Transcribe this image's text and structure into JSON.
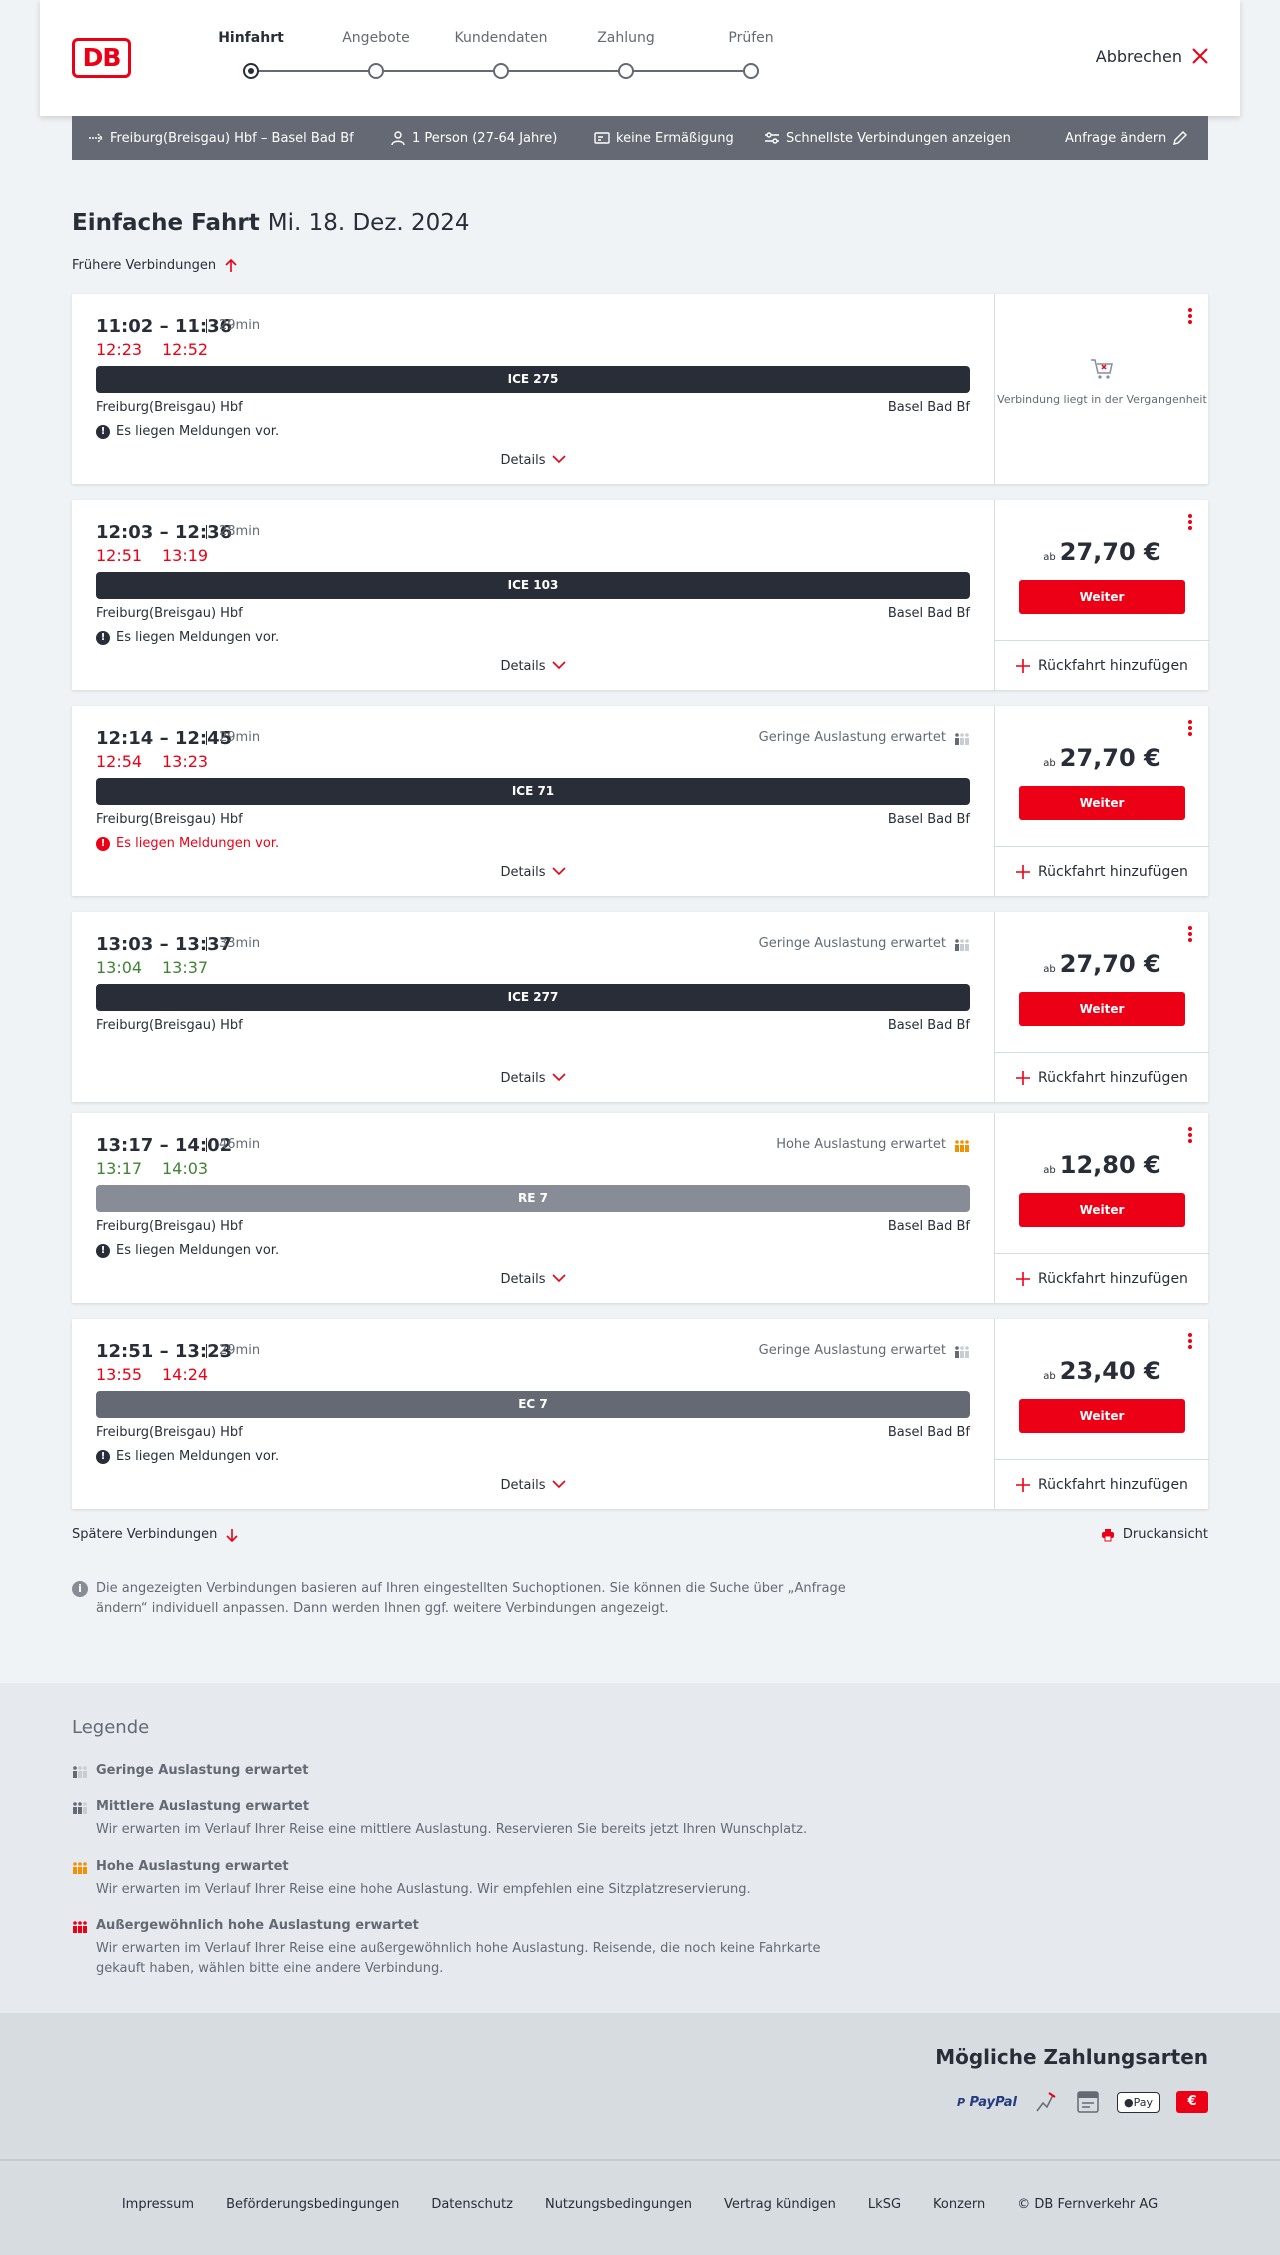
{
  "header": {
    "logo": "DB",
    "steps": [
      "Hinfahrt",
      "Angebote",
      "Kundendaten",
      "Zahlung",
      "Prüfen"
    ],
    "active_step": 0,
    "cancel": "Abbrechen"
  },
  "query": {
    "route": "Freiburg(Breisgau) Hbf – Basel Bad Bf",
    "persons": "1 Person (27-64 Jahre)",
    "discount": "keine Ermäßigung",
    "fastest": "Schnellste Verbindungen anzeigen",
    "change": "Anfrage ändern"
  },
  "page": {
    "title": "Einfache Fahrt",
    "date": "Mi. 18. Dez. 2024",
    "earlier": "Frühere Verbindungen",
    "later": "Spätere Verbindungen",
    "print": "Druckansicht",
    "info": "Die angezeigten Verbindungen basieren auf Ihren eingestellten Suchoptionen. Sie können die Suche über „Anfrage ändern“ individuell anpassen. Dann werden Ihnen ggf. weitere Verbindungen angezeigt."
  },
  "labels": {
    "details": "Details",
    "weiter": "Weiter",
    "rueckfahrt": "Rückfahrt hinzufügen",
    "ab": "ab",
    "past": "Verbindung liegt in der Vergangenheit"
  },
  "connections": [
    {
      "times": "11:02 – 11:36",
      "duration": "29min",
      "rt_dep": "12:23",
      "rt_arr": "12:52",
      "rt_status": "late",
      "load": "",
      "train": "ICE 275",
      "train_color": "#282d37",
      "from": "Freiburg(Breisgau) Hbf",
      "to": "Basel Bad Bf",
      "message": "Es liegen Meldungen vor.",
      "message_level": "info",
      "price": "",
      "past": true
    },
    {
      "times": "12:03 – 12:36",
      "duration": "28min",
      "rt_dep": "12:51",
      "rt_arr": "13:19",
      "rt_status": "late",
      "load": "",
      "train": "ICE 103",
      "train_color": "#282d37",
      "from": "Freiburg(Breisgau) Hbf",
      "to": "Basel Bad Bf",
      "message": "Es liegen Meldungen vor.",
      "message_level": "info",
      "price": "27,70 €",
      "past": false
    },
    {
      "times": "12:14 – 12:45",
      "duration": "29min",
      "rt_dep": "12:54",
      "rt_arr": "13:23",
      "rt_status": "late",
      "load": "Geringe Auslastung erwartet",
      "load_level": "low",
      "train": "ICE 71",
      "train_color": "#282d37",
      "from": "Freiburg(Breisgau) Hbf",
      "to": "Basel Bad Bf",
      "message": "Es liegen Meldungen vor.",
      "message_level": "warning",
      "price": "27,70 €",
      "past": false
    },
    {
      "times": "13:03 – 13:37",
      "duration": "33min",
      "rt_dep": "13:04",
      "rt_arr": "13:37",
      "rt_status": "ontime",
      "load": "Geringe Auslastung erwartet",
      "load_level": "low",
      "train": "ICE 277",
      "train_color": "#282d37",
      "from": "Freiburg(Breisgau) Hbf",
      "to": "Basel Bad Bf",
      "message": "",
      "message_level": "",
      "price": "27,70 €",
      "past": false
    },
    {
      "times": "13:17 – 14:02",
      "duration": "46min",
      "rt_dep": "13:17",
      "rt_arr": "14:03",
      "rt_status": "ontime",
      "load": "Hohe Auslastung erwartet",
      "load_level": "high",
      "train": "RE 7",
      "train_color": "#878c96",
      "from": "Freiburg(Breisgau) Hbf",
      "to": "Basel Bad Bf",
      "message": "Es liegen Meldungen vor.",
      "message_level": "info",
      "price": "12,80 €",
      "past": false
    },
    {
      "times": "12:51 – 13:23",
      "duration": "29min",
      "rt_dep": "13:55",
      "rt_arr": "14:24",
      "rt_status": "late",
      "load": "Geringe Auslastung erwartet",
      "load_level": "low",
      "train": "EC 7",
      "train_color": "#646973",
      "from": "Freiburg(Breisgau) Hbf",
      "to": "Basel Bad Bf",
      "message": "Es liegen Meldungen vor.",
      "message_level": "info",
      "price": "23,40 €",
      "past": false
    }
  ],
  "legend": {
    "title": "Legende",
    "items": [
      {
        "title": "Geringe Auslastung erwartet",
        "desc": "",
        "level": "low"
      },
      {
        "title": "Mittlere Auslastung erwartet",
        "desc": "Wir erwarten im Verlauf Ihrer Reise eine mittlere Auslastung. Reservieren Sie bereits jetzt Ihren Wunschplatz.",
        "level": "mid"
      },
      {
        "title": "Hohe Auslastung erwartet",
        "desc": "Wir erwarten im Verlauf Ihrer Reise eine hohe Auslastung. Wir empfehlen eine Sitzplatzreservierung.",
        "level": "high"
      },
      {
        "title": "Außergewöhnlich hohe Auslastung erwartet",
        "desc": "Wir erwarten im Verlauf Ihrer Reise eine außergewöhnlich hohe Auslastung. Reisende, die noch keine Fahrkarte gekauft haben, wählen bitte eine andere Verbindung.",
        "level": "extreme"
      }
    ]
  },
  "payment": {
    "title": "Mögliche Zahlungsarten",
    "methods": [
      "PayPal",
      "credit-card-icon",
      "sepa-icon",
      "Pay",
      "db-card-icon"
    ]
  },
  "footer": {
    "links": [
      "Impressum",
      "Beförderungsbedingungen",
      "Datenschutz",
      "Nutzungsbedingungen",
      "Vertrag kündigen",
      "LkSG",
      "Konzern",
      "© DB Fernverkehr AG"
    ]
  },
  "colors": {
    "accent": "#ec0016",
    "late": "#ec0016",
    "ontime": "#408335",
    "high_load": "#f39200"
  }
}
